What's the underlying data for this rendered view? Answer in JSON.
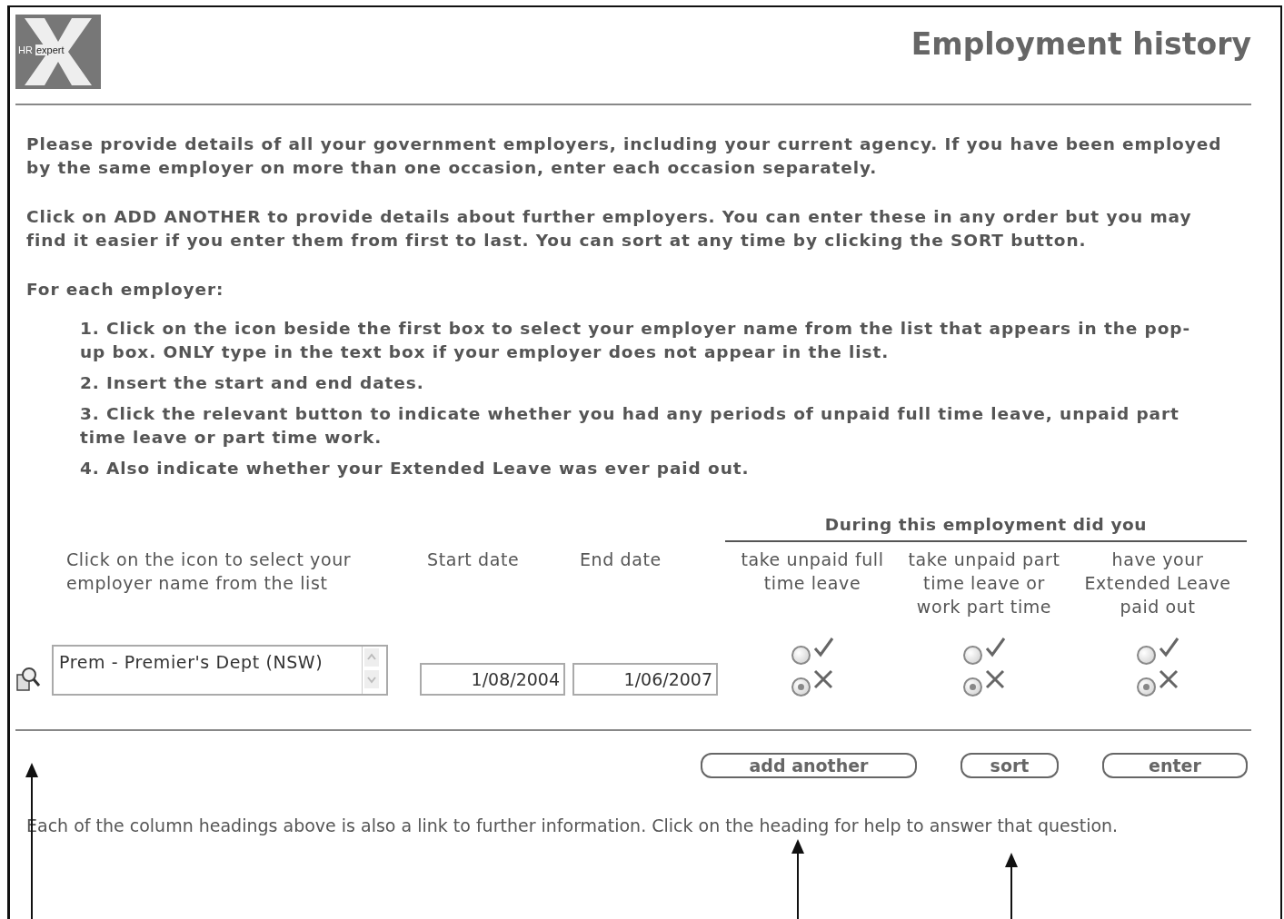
{
  "logo": {
    "text_light": "HR",
    "text_dark": "expert"
  },
  "title": "Employment history",
  "intro": [
    "Please provide details of all your government employers, including your current agency. If you have been employed by the same employer on more than one occasion, enter each occasion separately.",
    "Click on ADD ANOTHER to provide details about further employers. You can enter these in any order but you may find it easier if you enter them from first to last. You can sort at any time by clicking the SORT button.",
    "For each employer:"
  ],
  "steps": [
    "1. Click on the icon beside the first box to select your employer name from the list that appears in the pop-up box. ONLY type in the text box if your employer does not appear in the list.",
    "2. Insert the start and end dates.",
    "3. Click the relevant button to indicate whether you had any periods of unpaid full time leave, unpaid part time leave or part time work.",
    "4. Also indicate whether your Extended Leave was ever paid out."
  ],
  "table": {
    "group_heading": "During this employment did you",
    "employer_heading": "Click on the icon to select your employer name from the list",
    "start_heading": "Start date",
    "end_heading": "End date",
    "questions": [
      {
        "heading": "take unpaid full time leave",
        "options": [
          {
            "kind": "yes",
            "selected": false
          },
          {
            "kind": "no",
            "selected": true
          }
        ]
      },
      {
        "heading": "take unpaid part time leave or work part time",
        "options": [
          {
            "kind": "yes",
            "selected": false
          },
          {
            "kind": "no",
            "selected": true
          }
        ]
      },
      {
        "heading": "have your Extended Leave paid out",
        "options": [
          {
            "kind": "yes",
            "selected": false
          },
          {
            "kind": "no",
            "selected": true
          }
        ]
      }
    ],
    "row": {
      "employer": "Prem - Premier's Dept (NSW)",
      "start": "1/08/2004",
      "end": "1/06/2007"
    }
  },
  "buttons": [
    "add another",
    "sort",
    "enter"
  ],
  "footer": "Each of the column headings above is also a link to further information. Click on the heading for help to answer that question."
}
